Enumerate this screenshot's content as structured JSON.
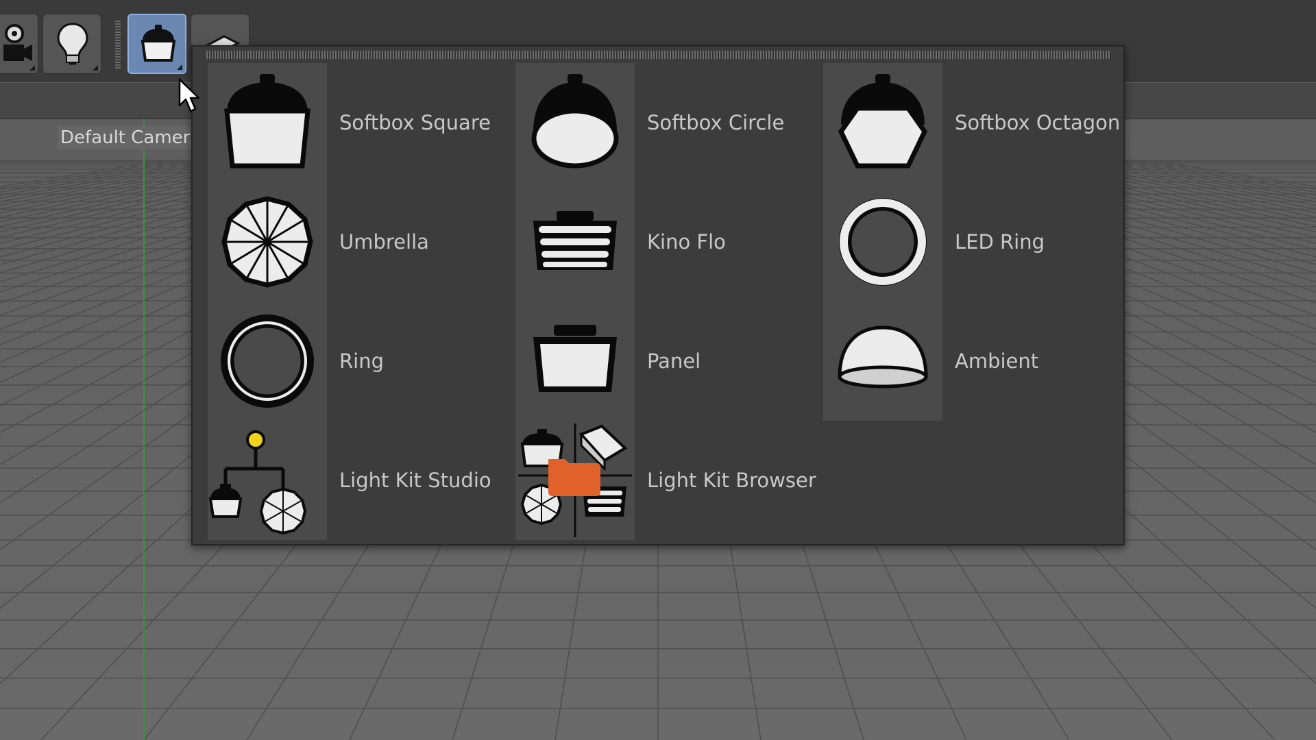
{
  "toolbar": {
    "buttons": [
      {
        "name": "camera",
        "icon": "camera-icon"
      },
      {
        "name": "light",
        "icon": "light-bulb-icon"
      },
      {
        "name": "softbox",
        "icon": "softbox-icon",
        "active": true
      },
      {
        "name": "area-light",
        "icon": "area-light-icon"
      }
    ]
  },
  "viewport": {
    "camera_label": "Default Camer"
  },
  "popup": {
    "items": [
      {
        "label": "Softbox Square",
        "icon": "softbox-square-icon"
      },
      {
        "label": "Softbox Circle",
        "icon": "softbox-circle-icon"
      },
      {
        "label": "Softbox Octagon",
        "icon": "softbox-octagon-icon"
      },
      {
        "label": "Umbrella",
        "icon": "umbrella-icon"
      },
      {
        "label": "Kino Flo",
        "icon": "kino-flo-icon"
      },
      {
        "label": "LED Ring",
        "icon": "led-ring-icon"
      },
      {
        "label": "Ring",
        "icon": "ring-icon"
      },
      {
        "label": "Panel",
        "icon": "panel-icon"
      },
      {
        "label": "Ambient",
        "icon": "ambient-icon"
      },
      {
        "label": "Light Kit Studio",
        "icon": "light-kit-studio-icon"
      },
      {
        "label": "Light Kit Browser",
        "icon": "light-kit-browser-icon"
      }
    ]
  },
  "colors": {
    "active_button": "#6a88b2",
    "popup_bg": "#3c3c3c",
    "icon_cell_bg": "#4a4a4a",
    "label_text": "#c8c8c8",
    "folder_orange": "#e0622a",
    "studio_yellow": "#f2d21a"
  }
}
